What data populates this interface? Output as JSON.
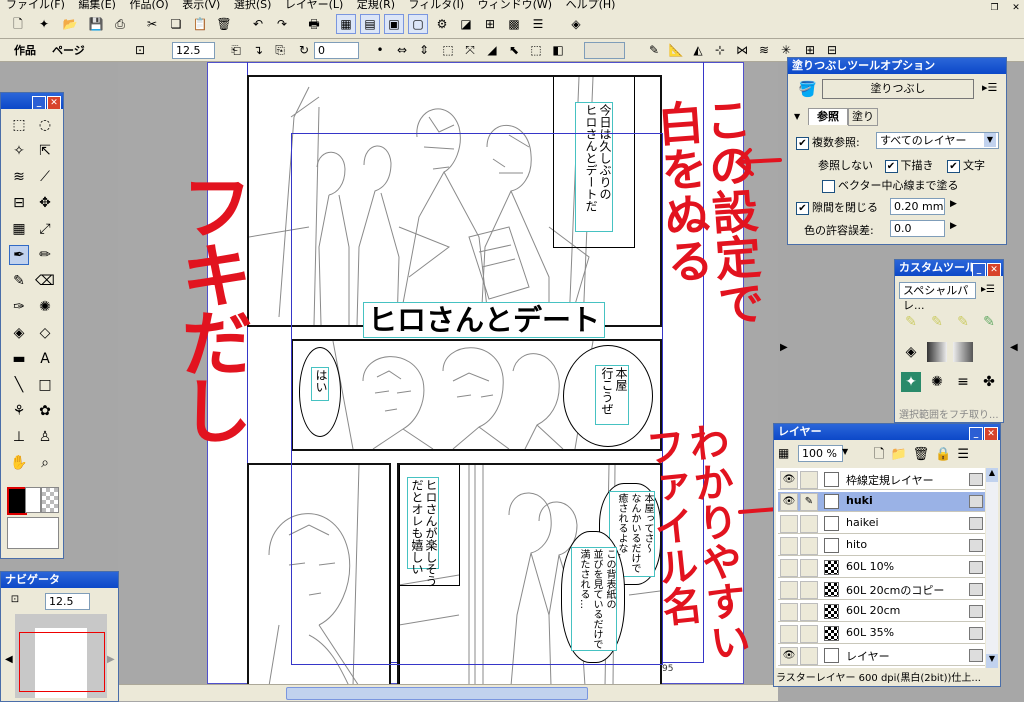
{
  "menu": {
    "items": [
      "ファイル(F)",
      "編集(E)",
      "作品(O)",
      "表示(V)",
      "選択(S)",
      "レイヤー(L)",
      "定規(R)",
      "フィルタ(I)",
      "ウィンドウ(W)",
      "ヘルプ(H)"
    ]
  },
  "toolbar2": {
    "tab_work": "作品",
    "tab_page": "ページ",
    "zoom_value": "12.5",
    "rotate_value": "0"
  },
  "tools_panel": {
    "icons": [
      "marquee-icon",
      "lasso-icon",
      "magic-wand-icon",
      "object-select-icon",
      "layer-move-icon",
      "eyedropper-icon",
      "ruler-icon",
      "move-icon",
      "grid-icon",
      "transform-icon",
      "pen-icon",
      "pencil-icon",
      "marker-icon",
      "eraser-icon",
      "brush-icon",
      "airbrush-icon",
      "fill-icon",
      "pattern-fill-icon",
      "gradient-icon",
      "text-icon",
      "line-icon",
      "rect-icon",
      "tone-icon",
      "tone-brush-icon",
      "blur-icon",
      "stamp-icon",
      "hand-icon",
      "zoom-icon"
    ]
  },
  "navigator": {
    "title": "ナビゲータ",
    "zoom_value": "12.5"
  },
  "fill_panel": {
    "title": "塗りつぶしツールオプション",
    "button_label": "塗りつぶし",
    "tab_ref": "参照",
    "tab_fill": "塗り",
    "multi_ref_label": "複数参照:",
    "multi_ref_value": "すべてのレイヤー",
    "no_ref_label": "参照しない",
    "draft_label": "下描き",
    "text_label": "文字",
    "vector_center_label": "ベクター中心線まで塗る",
    "close_gap_label": "隙間を閉じる",
    "close_gap_value": "0.20 mm",
    "color_tolerance_label": "色の許容誤差:",
    "color_tolerance_value": "0.0"
  },
  "custom_panel": {
    "title": "カスタムツール",
    "select_value": "スペシャルパレ...",
    "footer": "選択範囲をフチ取り..."
  },
  "layers_panel": {
    "title": "レイヤー",
    "opacity_value": "100 %",
    "layers": [
      {
        "name": "枠線定規レイヤー",
        "visible": true,
        "edit": false,
        "type": "page",
        "selected": false
      },
      {
        "name": "huki",
        "visible": true,
        "edit": true,
        "type": "page",
        "selected": true
      },
      {
        "name": "haikei",
        "visible": false,
        "edit": false,
        "type": "page",
        "selected": false
      },
      {
        "name": "hito",
        "visible": false,
        "edit": false,
        "type": "page",
        "selected": false
      },
      {
        "name": "60L 10%",
        "visible": false,
        "edit": false,
        "type": "tone",
        "selected": false
      },
      {
        "name": "60L 20cmのコピー",
        "visible": false,
        "edit": false,
        "type": "tone",
        "selected": false
      },
      {
        "name": "60L 20cm",
        "visible": false,
        "edit": false,
        "type": "tone",
        "selected": false
      },
      {
        "name": "60L 35%",
        "visible": false,
        "edit": false,
        "type": "tone",
        "selected": false
      },
      {
        "name": "レイヤー",
        "visible": true,
        "edit": false,
        "type": "page",
        "selected": false
      }
    ],
    "status": "ラスターレイヤー 600 dpi(黒白(2bit))仕上..."
  },
  "manga": {
    "title_text": "ヒロさんとデート",
    "page_number": "95",
    "narration_1": "今日は久しぶりの\nヒロさんとデートだ",
    "bubble_hai": "はい",
    "bubble_honya": "本屋\n行こうぜ",
    "narration_2": "ヒロさんが楽しそう\nだとオレも嬉しい",
    "bubble_ryaku": "本屋ってさ～\nなんかいるだけで\n癒されるよな…",
    "bubble_sebyoshi": "この背表紙の\n並びを見ているだけで\n満たされる…"
  },
  "annotations": {
    "fukidashi": "フキだし",
    "settings_note": "この設定で\n白をぬる",
    "filename_note": "わかりやすい\nファイル名"
  },
  "colors": {
    "annotation_red": "#e2131f",
    "panel_title_blue": "#0c48c8",
    "guide_blue": "#3636c8",
    "text_frame_cyan": "#46c2c2"
  }
}
